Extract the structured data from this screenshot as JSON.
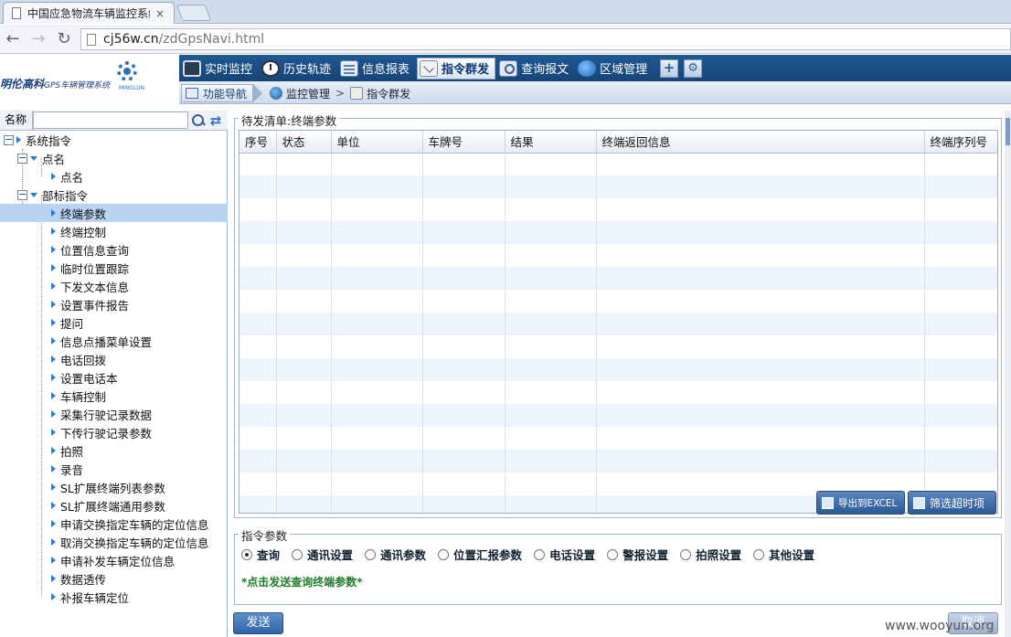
{
  "browser": {
    "tab_title": "中国应急物流车辆监控系统",
    "tab_close": "×",
    "url_host": "cj56w.cn",
    "url_path": "/zdGpsNavi.html",
    "back": "←",
    "forward": "→",
    "reload": "↻"
  },
  "header": {
    "brand": "明伦高科",
    "brand_sub": "GPS车辆管理系统",
    "brand_mini": "MINGLUN",
    "menu": [
      {
        "label": "实时监控",
        "icon": "monitor-icon"
      },
      {
        "label": "历史轨迹",
        "icon": "clock-icon"
      },
      {
        "label": "信息报表",
        "icon": "report-icon"
      },
      {
        "label": "指令群发",
        "icon": "mail-icon"
      },
      {
        "label": "查询报文",
        "icon": "search-doc-icon"
      },
      {
        "label": "区域管理",
        "icon": "globe-icon"
      }
    ],
    "active_menu": "指令群发",
    "plus": "+",
    "settings": "⚙"
  },
  "breadcrumb": {
    "nav": "功能导航",
    "level1": "监控管理",
    "sep": ">",
    "level2": "指令群发"
  },
  "left": {
    "search_label": "名称",
    "search_value": "",
    "refresh": "⇄",
    "tree": {
      "root": "系统指令",
      "group1": "点名",
      "group1_items": [
        "点名"
      ],
      "group2": "部标指令",
      "group2_items": [
        "终端参数",
        "终端控制",
        "位置信息查询",
        "临时位置跟踪",
        "下发文本信息",
        "设置事件报告",
        "提问",
        "信息点播菜单设置",
        "电话回拨",
        "设置电话本",
        "车辆控制",
        "采集行驶记录数据",
        "下传行驶记录参数",
        "拍照",
        "录音",
        "SL扩展终端列表参数",
        "SL扩展终端通用参数",
        "申请交换指定车辆的定位信息",
        "取消交换指定车辆的定位信息",
        "申请补发车辆定位信息",
        "数据透传",
        "补报车辆定位"
      ],
      "selected": "终端参数"
    }
  },
  "list": {
    "legend": "待发清单:终端参数",
    "columns": [
      "序号",
      "状态",
      "单位",
      "车牌号",
      "结果",
      "终端返回信息",
      "终端序列号"
    ],
    "rows": [],
    "export_button": "导出到EXCEL",
    "filter_button": "筛选超时项"
  },
  "params": {
    "legend": "指令参数",
    "options": [
      "查询",
      "通讯设置",
      "通讯参数",
      "位置汇报参数",
      "电话设置",
      "警报设置",
      "拍照设置",
      "其他设置"
    ],
    "selected": "查询",
    "hint": "*点击发送查询终端参数*"
  },
  "actions": {
    "send": "发送",
    "cancel": "取消"
  },
  "watermark": "www.wooyun.org"
}
